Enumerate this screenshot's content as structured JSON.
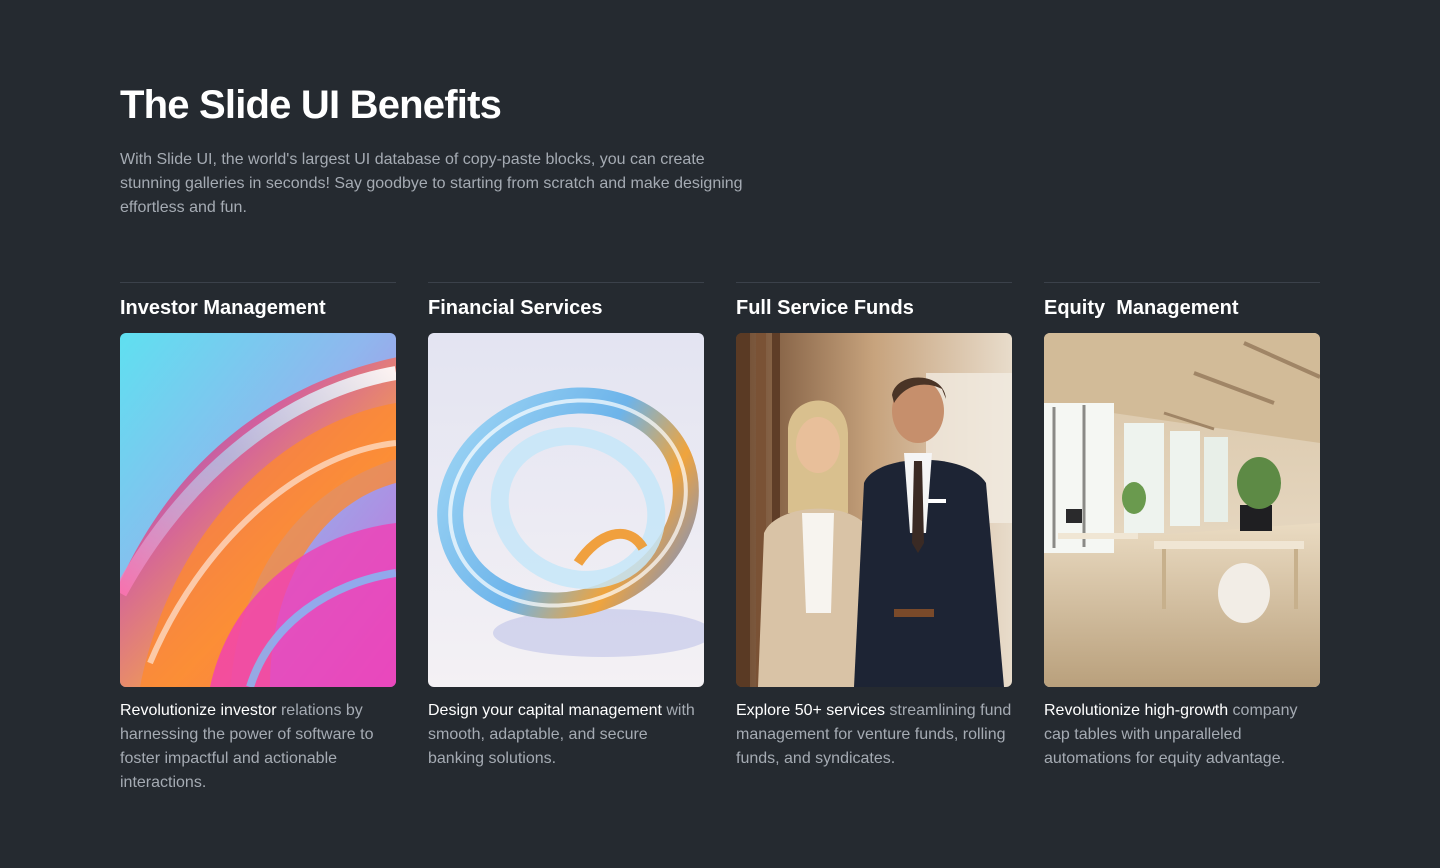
{
  "section": {
    "title": "The Slide UI Benefits",
    "lead": "With Slide UI, the world's largest UI database of copy-paste blocks, you can create stunning galleries in seconds! Say goodbye to starting from scratch and make designing effortless and fun."
  },
  "cards": [
    {
      "title": "Investor Management",
      "image": "abstract-iridescent-swirl-image",
      "desc_highlight": "Revolutionize investor",
      "desc_rest": " relations by harnessing the power of software to foster impactful and actionable interactions."
    },
    {
      "title": "Financial Services",
      "image": "glass-ring-sculpture-image",
      "desc_highlight": "Design your capital management",
      "desc_rest": " with smooth, adaptable, and secure banking solutions."
    },
    {
      "title": "Full Service Funds",
      "image": "business-people-portrait-image",
      "desc_highlight": "Explore 50+ services",
      "desc_rest": " streamlining fund management for venture funds, rolling funds, and syndicates."
    },
    {
      "title": "Equity  Management",
      "image": "bright-office-interior-image",
      "desc_highlight": "Revolutionize high-growth",
      "desc_rest": " company cap tables with unparalleled automations for equity advantage."
    }
  ],
  "colors": {
    "background": "#252a30",
    "text_primary": "#ffffff",
    "text_muted": "#a5abb3",
    "divider": "#3b414a"
  }
}
